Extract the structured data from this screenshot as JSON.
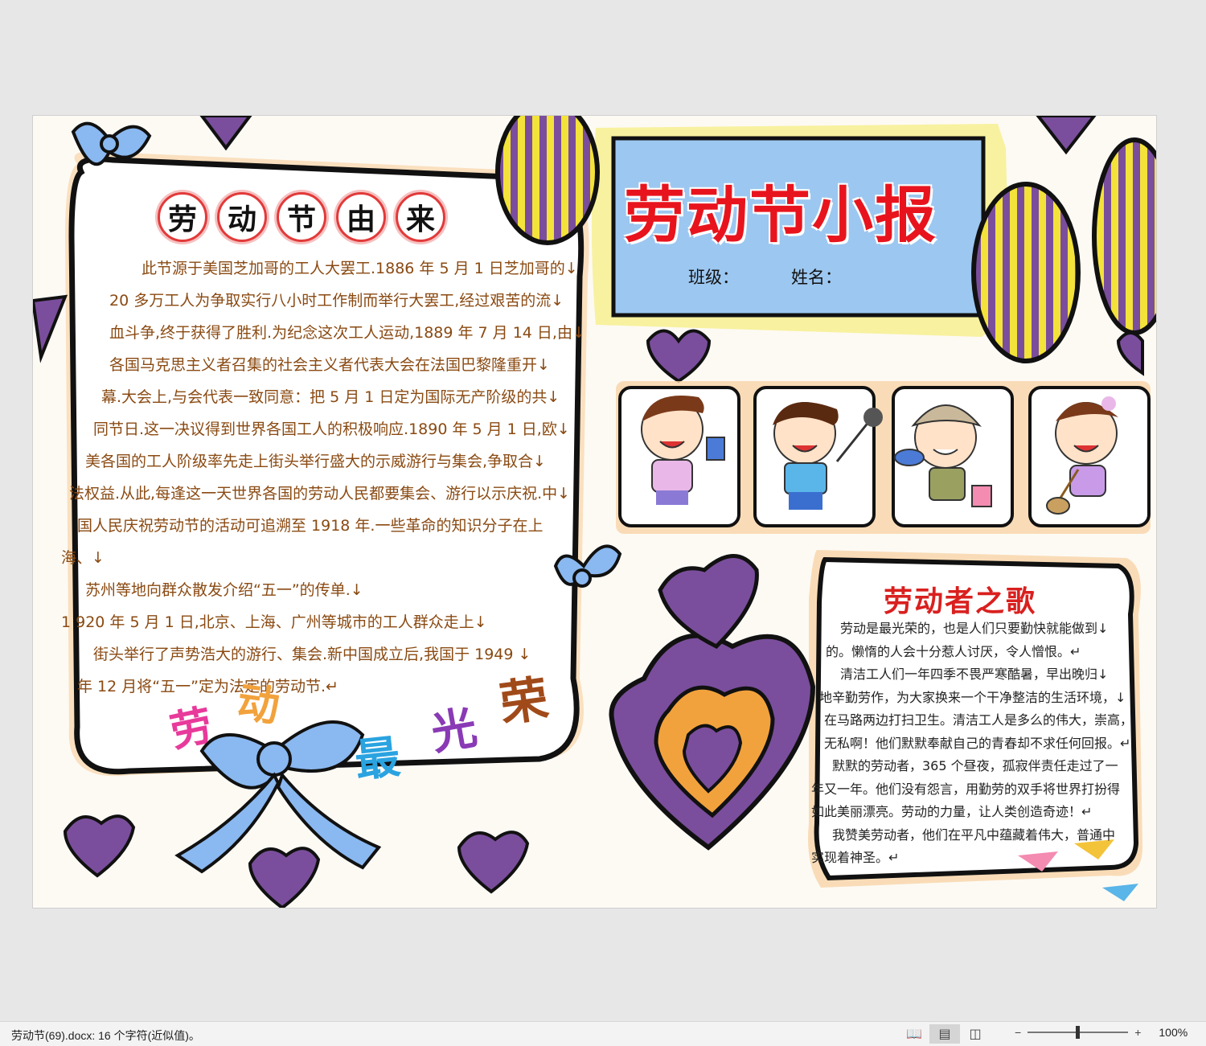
{
  "poster": {
    "title": "劳动节小报",
    "class_label": "班级：",
    "name_label": "姓名：",
    "origin_title_chars": [
      "劳",
      "动",
      "节",
      "由",
      "来"
    ],
    "origin_lines": [
      "此节源于美国芝加哥的工人大罢工.1886 年 5 月 1 日芝加哥的↓",
      "20 多万工人为争取实行八小时工作制而举行大罢工,经过艰苦的流↓",
      "血斗争,终于获得了胜利.为纪念这次工人运动,1889 年 7 月 14 日,由↓",
      "各国马克思主义者召集的社会主义者代表大会在法国巴黎隆重开↓",
      "幕.大会上,与会代表一致同意：把 5 月 1 日定为国际无产阶级的共↓",
      "同节日.这一决议得到世界各国工人的积极响应.1890 年 5 月 1 日,欧↓",
      "美各国的工人阶级率先走上街头举行盛大的示威游行与集会,争取合↓",
      "法权益.从此,每逢这一天世界各国的劳动人民都要集会、游行以示庆祝.中↓",
      "国人民庆祝劳动节的活动可追溯至  1918  年.一些革命的知识分子在上",
      "海、↓",
      "苏州等地向群众散发介绍“五一”的传单.↓",
      "1            920 年 5 月 1 日,北京、上海、广州等城市的工人群众走上↓",
      "街头举行了声势浩大的游行、集会.新中国成立后,我国于 1949 ↓",
      "年 12 月将“五一”定为法定的劳动节.↵"
    ],
    "slogan_chars": [
      "劳",
      "动",
      "最",
      "光",
      "荣"
    ],
    "song_title": "劳动者之歌",
    "song_lines": [
      "　劳动是最光荣的，也是人们只要勤快就能做到↓",
      "的。懒惰的人会十分惹人讨厌，令人憎恨。↵",
      "　清洁工人们一年四季不畏严寒酷暑，早出晚归↓",
      "地辛勤劳作，为大家换来一个干净整洁的生活环境，↓",
      "在马路两边打扫卫生。清洁工人是多么的伟大，崇高，",
      "无私啊！他们默默奉献自己的青春却不求任何回报。↵",
      "　默默的劳动者，365 个昼夜，孤寂伴责任走过了一",
      "年又一年。他们没有怨言，用勤劳的双手将世界打扮得",
      "如此美丽漂亮。劳动的力量，让人类创造奇迹！↵",
      "　我赞美劳动者，他们在平凡中蕴藏着伟大，普通中",
      "实现着神圣。↵"
    ]
  },
  "statusbar": {
    "file_info": "劳动节(69).docx: 16 个字符(近似值)。",
    "zoom_minus": "−",
    "zoom_plus": "+",
    "zoom_level": "100%",
    "view_icons": [
      "read-mode-icon",
      "print-layout-icon",
      "web-layout-icon"
    ]
  },
  "colors": {
    "title_red": "#e8141d",
    "origin_text": "#8a4a12",
    "purple": "#7a4e9c",
    "sky": "#8ab8f0",
    "yellow": "#f3e23a",
    "orange": "#f2a23c"
  }
}
